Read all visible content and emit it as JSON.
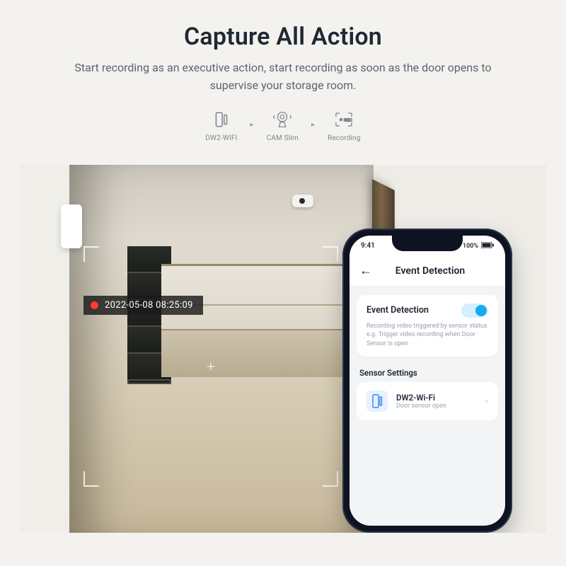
{
  "hero": {
    "title": "Capture All Action",
    "subtitle": "Start recording as an executive action, start recording as soon as the door opens to supervise your storage room."
  },
  "flow": {
    "nodes": [
      {
        "label": "DW2-WIFI"
      },
      {
        "label": "CAM Slim"
      },
      {
        "label": "Recording"
      }
    ]
  },
  "recording": {
    "timestamp": "2022-05-08 08:25:09"
  },
  "phone": {
    "status_time": "9:41",
    "battery_label": "100%",
    "nav_title": "Event Detection",
    "card": {
      "title": "Event Detection",
      "desc_line1": "Recording video triggered by sensor status",
      "desc_line2": "e.g. Trigger video recording when Door Sensor is open"
    },
    "section_label": "Sensor Settings",
    "sensor": {
      "name": "DW2-Wi-Fi",
      "sub": "Door sensor open"
    }
  }
}
